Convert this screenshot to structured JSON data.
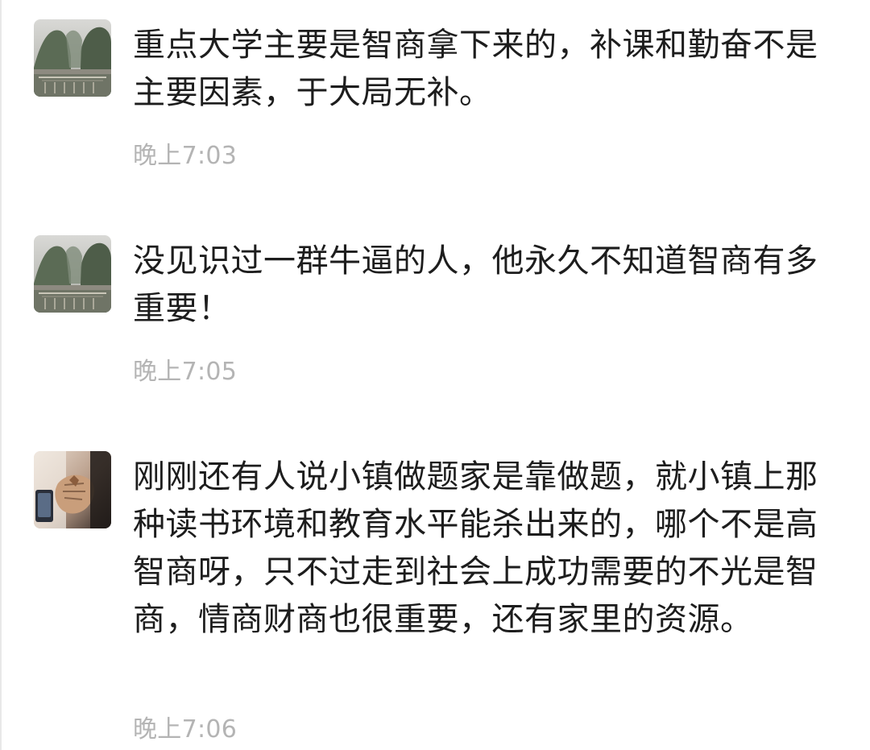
{
  "messages": [
    {
      "avatar_icon": "scenic-bridge-avatar-icon",
      "text": "重点大学主要是智商拿下来的，补课和勤奋不是主要因素，于大局无补。",
      "time": "晚上7:03"
    },
    {
      "avatar_icon": "scenic-bridge-avatar-icon",
      "text": "没见识过一群牛逼的人，他永久不知道智商有多重要！",
      "time": "晚上7:05"
    },
    {
      "avatar_icon": "hand-photo-avatar-icon",
      "text": "刚刚还有人说小镇做题家是靠做题，就小镇上那种读书环境和教育水平能杀出来的，哪个不是高智商呀，只不过走到社会上成功需要的不光是智商，情商财商也很重要，还有家里的资源。",
      "time": "晚上7:06"
    }
  ]
}
